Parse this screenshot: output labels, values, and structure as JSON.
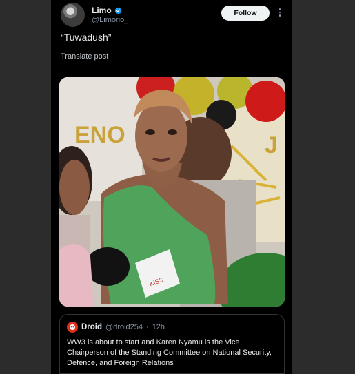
{
  "author": {
    "display_name": "Limo",
    "handle": "@Limorio_",
    "verified": true,
    "avatar_icon": "avatar-photo"
  },
  "follow_label": "Follow",
  "post": {
    "text": "“Tuwadush”",
    "translate_label": "Translate post"
  },
  "media": {
    "type": "video-still",
    "icon": "video-frame"
  },
  "quoted": {
    "display_name": "Droid",
    "handle": "@droid254",
    "separator": "·",
    "time": "12h",
    "text": "WW3 is about to start and Karen Nyamu is the Vice Chairperson of the Standing Committee on National Security, Defence, and Foreign Relations"
  },
  "colors": {
    "background": "#000000",
    "sidebar": "#2c2c2c",
    "verified": "#1d9bf0",
    "follow_bg": "#eff3f4"
  }
}
